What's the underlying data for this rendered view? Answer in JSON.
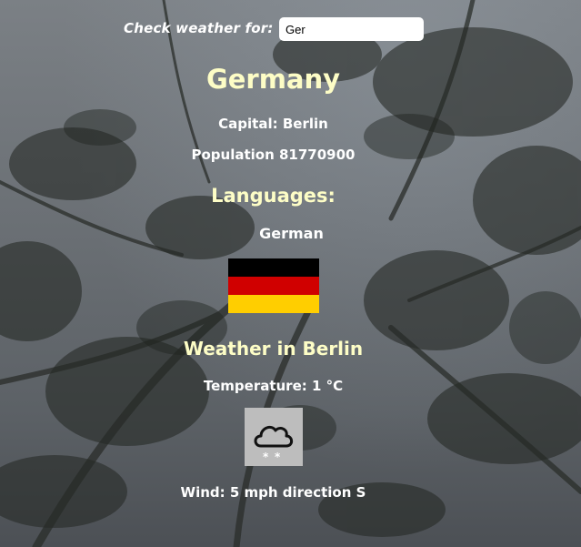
{
  "search": {
    "label": "Check weather for:",
    "value": "Ger"
  },
  "country": {
    "name": "Germany",
    "capital": "Capital: Berlin",
    "population": "Population 81770900",
    "languages_heading": "Languages:",
    "languages": [
      "German"
    ],
    "flag_colors": [
      "#000000",
      "#d00000",
      "#ffce00"
    ]
  },
  "weather": {
    "heading": "Weather in Berlin",
    "temperature": "Temperature: 1 °C",
    "icon": "cloud-snow-icon",
    "wind": "Wind: 5 mph direction S"
  },
  "colors": {
    "heading_accent": "#fdfdc6",
    "text": "#ffffff"
  }
}
